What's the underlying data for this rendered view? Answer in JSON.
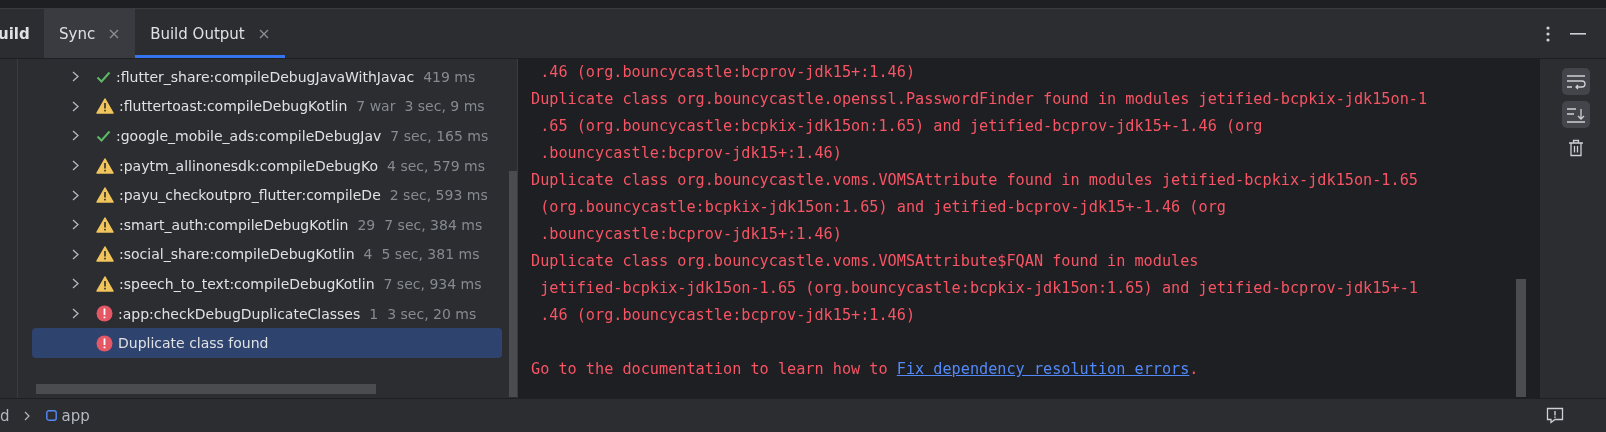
{
  "tool_window": {
    "tabs": [
      {
        "label": "uild",
        "kind": "title"
      },
      {
        "label": "Sync",
        "kind": "tab",
        "selected": false
      },
      {
        "label": "Build Output",
        "kind": "tab",
        "selected": true
      }
    ]
  },
  "build_tree": {
    "rows": [
      {
        "kind": "success",
        "name": ":flutter_share:compileDebugJavaWithJavac",
        "time": "419 ms",
        "expandable": true,
        "selected": false
      },
      {
        "kind": "warning",
        "name": ":fluttertoast:compileDebugKotlin",
        "note": "7 war",
        "time": "3 sec, 9 ms",
        "expandable": true,
        "selected": false
      },
      {
        "kind": "success",
        "name": ":google_mobile_ads:compileDebugJav",
        "time": "7 sec, 165 ms",
        "expandable": true,
        "selected": false
      },
      {
        "kind": "warning",
        "name": ":paytm_allinonesdk:compileDebugKo",
        "time": "4 sec, 579 ms",
        "expandable": true,
        "selected": false
      },
      {
        "kind": "warning",
        "name": ":payu_checkoutpro_flutter:compileDe",
        "time": "2 sec, 593 ms",
        "expandable": true,
        "selected": false
      },
      {
        "kind": "warning",
        "name": ":smart_auth:compileDebugKotlin",
        "note": "29",
        "time": "7 sec, 384 ms",
        "expandable": true,
        "selected": false
      },
      {
        "kind": "warning",
        "name": ":social_share:compileDebugKotlin",
        "note": "4",
        "time": "5 sec, 381 ms",
        "expandable": true,
        "selected": false
      },
      {
        "kind": "warning",
        "name": ":speech_to_text:compileDebugKotlin",
        "time": "7 sec, 934 ms",
        "expandable": true,
        "selected": false
      },
      {
        "kind": "error",
        "name": ":app:checkDebugDuplicateClasses",
        "note": "1",
        "time": "3 sec, 20 ms",
        "expandable": true,
        "selected": false
      },
      {
        "kind": "error",
        "name": "Duplicate class found",
        "expandable": false,
        "selected": true
      }
    ]
  },
  "output": {
    "messages": [
      {
        "lines": [
          " .46 (org.bouncycastle:bcprov-jdk15+:1.46)"
        ]
      },
      {
        "lines": [
          "Duplicate class org.bouncycastle.openssl.PasswordFinder found in modules jetified-bcpkix-jdk15on-1",
          " .65 (org.bouncycastle:bcpkix-jdk15on:1.65) and jetified-bcprov-jdk15+-1.46 (org",
          " .bouncycastle:bcprov-jdk15+:1.46)"
        ]
      },
      {
        "lines": [
          "Duplicate class org.bouncycastle.voms.VOMSAttribute found in modules jetified-bcpkix-jdk15on-1.65",
          " (org.bouncycastle:bcpkix-jdk15on:1.65) and jetified-bcprov-jdk15+-1.46 (org",
          " .bouncycastle:bcprov-jdk15+:1.46)"
        ]
      },
      {
        "lines": [
          "Duplicate class org.bouncycastle.voms.VOMSAttribute$FQAN found in modules",
          " jetified-bcpkix-jdk15on-1.65 (org.bouncycastle:bcpkix-jdk15on:1.65) and jetified-bcprov-jdk15+-1",
          " .46 (org.bouncycastle:bcprov-jdk15+:1.46)"
        ]
      }
    ],
    "footer": {
      "text": "Go to the documentation to learn how to ",
      "link": "Fix dependency resolution errors",
      "after": "."
    }
  },
  "toolbar": [
    {
      "kind": "soft-wrap",
      "on": true
    },
    {
      "kind": "scroll-end",
      "on": true
    },
    {
      "kind": "clear",
      "on": false
    }
  ],
  "breadcrumb": [
    {
      "label": "d",
      "kind": "text"
    },
    {
      "label": "app",
      "kind": "module"
    }
  ]
}
